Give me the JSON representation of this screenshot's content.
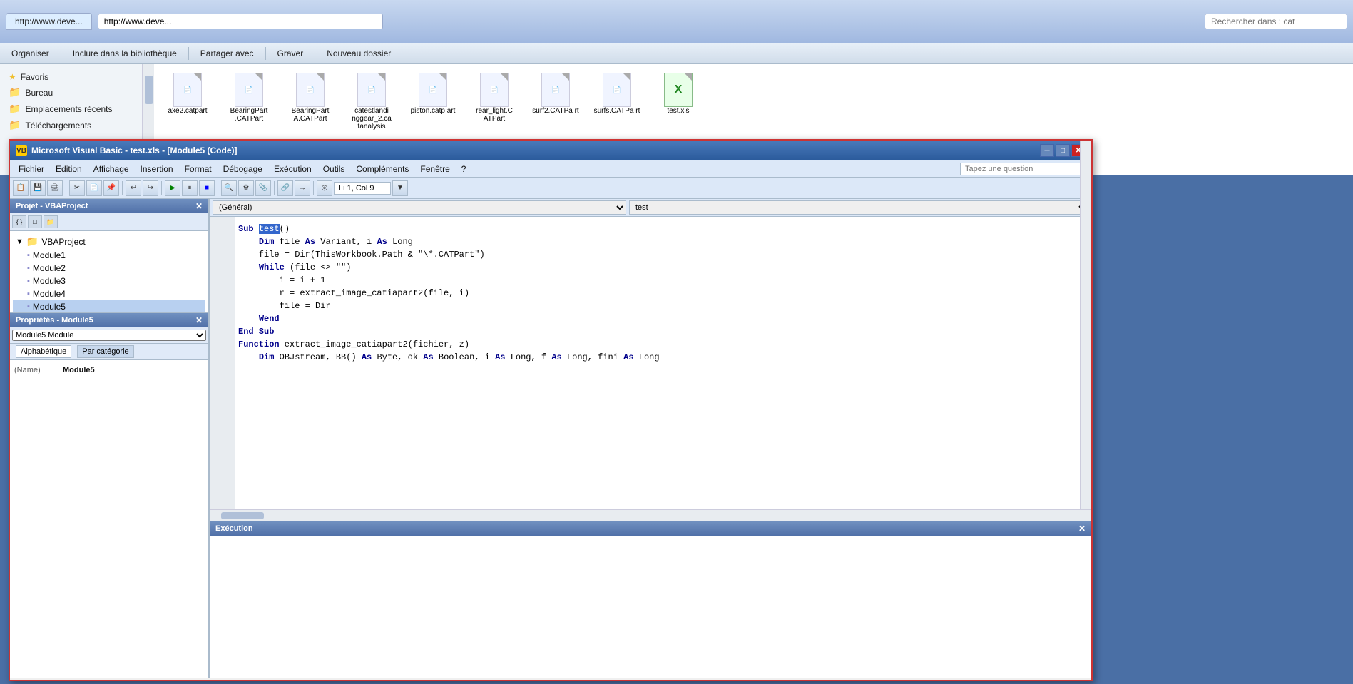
{
  "browser": {
    "tab_label": "http://www.deve...",
    "address": "http://www.deve...",
    "search_placeholder": "Rechercher dans : cat",
    "path": "cat"
  },
  "explorer": {
    "organizer_label": "Organiser",
    "library_label": "Inclure dans la bibliothèque",
    "share_label": "Partager avec",
    "burn_label": "Graver",
    "new_folder_label": "Nouveau dossier",
    "sidebar_items": [
      {
        "label": "Favoris",
        "icon": "star"
      },
      {
        "label": "Bureau",
        "icon": "folder"
      },
      {
        "label": "Emplacements récents",
        "icon": "folder"
      },
      {
        "label": "Téléchargements",
        "icon": "folder"
      }
    ],
    "files": [
      {
        "name": "axe2.catpart",
        "type": "catpart"
      },
      {
        "name": "BearingPart.CATPart",
        "type": "catpart"
      },
      {
        "name": "BearingPartA.CATPart",
        "type": "catpart"
      },
      {
        "name": "catestlandingear_2.catanalysis",
        "type": "catanalysis"
      },
      {
        "name": "piston.catp art",
        "type": "catpart"
      },
      {
        "name": "rear_light.CATPart",
        "type": "catpart"
      },
      {
        "name": "surf2.CATPart",
        "type": "catpart"
      },
      {
        "name": "surfs.CATPart",
        "type": "catpart"
      },
      {
        "name": "test.xls",
        "type": "xls"
      }
    ]
  },
  "vba": {
    "title": "Microsoft Visual Basic - test.xls - [Module5 (Code)]",
    "menu": {
      "items": [
        "Fichier",
        "Edition",
        "Affichage",
        "Insertion",
        "Format",
        "Débogage",
        "Exécution",
        "Outils",
        "Compléments",
        "Fenêtre",
        "?"
      ]
    },
    "toolbar": {
      "pos_indicator": "Li 1, Col 9",
      "ask_placeholder": "Tapez une question"
    },
    "project_panel": {
      "title": "Projet - VBAProject",
      "modules": [
        "Module1",
        "Module2",
        "Module3",
        "Module4",
        "Module5"
      ]
    },
    "props_panel": {
      "title": "Propriétés - Module5",
      "dropdown_value": "Module5 Module",
      "tabs": [
        "Alphabétique",
        "Par catégorie"
      ],
      "active_tab": "Alphabétique",
      "name_label": "(Name)",
      "name_value": "Module5"
    },
    "code": {
      "left_select": "(Général)",
      "right_select": "test",
      "lines": [
        "Sub test()",
        "    Dim file As Variant, i As Long",
        "    file = Dir(ThisWorkbook.Path & \"\\*.CATPart\")",
        "    While (file <> \"\")",
        "        i = i + 1",
        "        r = extract_image_catiapart2(file, i)",
        "        file = Dir",
        "    Wend",
        "End Sub",
        "",
        "Function extract_image_catiapart2(fichier, z)",
        "    Dim OBJstream, BB() As Byte, ok As Boolean, i As Long, f As Long, fini As Long"
      ]
    },
    "execution_panel": {
      "title": "Exécution"
    },
    "statusbar": {
      "text": ""
    }
  }
}
